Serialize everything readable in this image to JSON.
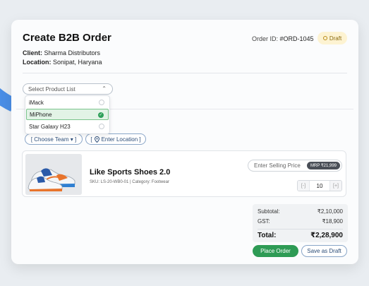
{
  "header": {
    "title": "Create B2B Order",
    "client_label": "Client:",
    "client_value": "Sharma Distributors",
    "location_label": "Location:",
    "location_value": "Sonipat, Haryana",
    "order_id_label": "Order ID:",
    "order_id_value": "#ORD-1045",
    "status": "Draft"
  },
  "product_list": {
    "placeholder": "Select Product List",
    "options": [
      {
        "label": "iMack",
        "selected": false
      },
      {
        "label": "MiPhone",
        "selected": true
      },
      {
        "label": "Star Galaxy H23",
        "selected": false
      }
    ]
  },
  "filters": {
    "team": "[ Choose Team ▾ ]",
    "location": "Enter Location ]",
    "location_prefix": "["
  },
  "product": {
    "name": "Like Sports Shoes 2.0",
    "sku": "SKU: LS-20-WB0-01 | Category: Footwear",
    "price_placeholder": "Enter Selling Price",
    "mrp": "MRP ₹21,999",
    "qty": "10",
    "minus": "[-]",
    "plus": "[+]"
  },
  "summary": {
    "subtotal_label": "Subtotal:",
    "subtotal_value": "₹2,10,000",
    "gst_label": "GST:",
    "gst_value": "₹18,900",
    "total_label": "Total:",
    "total_value": "₹2,28,900"
  },
  "actions": {
    "place_order": "Place Order",
    "save_draft": "Save as Draft"
  },
  "colors": {
    "accent_green": "#2e9b55",
    "draft_bg": "#fdf3d2",
    "outline_blue": "#8aa6c8"
  },
  "icons": [
    "chevron-down-icon",
    "check-icon",
    "location-pin-icon",
    "ring-icon"
  ]
}
